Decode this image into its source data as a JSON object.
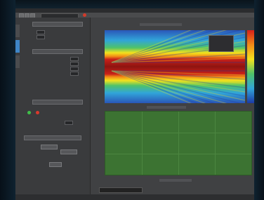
{
  "window": {
    "menu_items": [
      "",
      "",
      "",
      ""
    ],
    "toolbar_field_value": ""
  },
  "left_panel": {
    "sections": [
      {
        "id": "s1",
        "title": ""
      },
      {
        "id": "s2",
        "title": ""
      },
      {
        "id": "s3",
        "title": ""
      },
      {
        "id": "s4",
        "title": ""
      }
    ],
    "fields": [
      {
        "label": "",
        "value": ""
      },
      {
        "label": "",
        "value": ""
      },
      {
        "label": "",
        "value": ""
      },
      {
        "label": "",
        "value": ""
      },
      {
        "label": "",
        "value": ""
      },
      {
        "label": "",
        "value": ""
      },
      {
        "label": "",
        "value": ""
      }
    ],
    "buttons": [
      {
        "label": ""
      },
      {
        "label": ""
      },
      {
        "label": ""
      }
    ],
    "indicators": [
      {
        "name": "status-green",
        "color": "#3fbf49"
      },
      {
        "name": "status-red",
        "color": "#d9392c"
      }
    ]
  },
  "plots": {
    "top_title": "",
    "bottom_title": "",
    "x_label": "",
    "colormap": [
      "#1c3aa6",
      "#31a5d9",
      "#4ec26a",
      "#f2e21d",
      "#f28a17",
      "#d7201a"
    ],
    "bottom_fill_color": "#3c7332"
  },
  "status_bar": {
    "field_value": ""
  }
}
